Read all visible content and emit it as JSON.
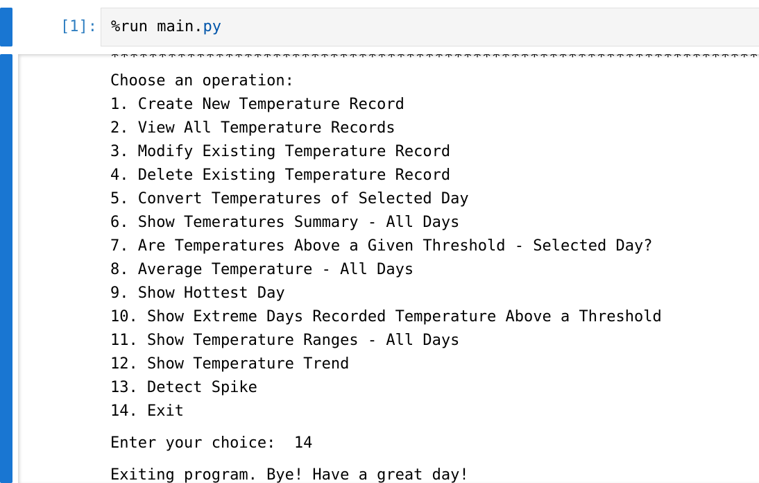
{
  "input_cell": {
    "prompt": "[1]:",
    "code_magic": "%run main",
    "code_dot": ".",
    "code_ext": "py"
  },
  "output": {
    "separator": "**********************************************************************************************",
    "heading": "Choose an operation:",
    "menu_items": [
      "1. Create New Temperature Record",
      "2. View All Temperature Records",
      "3. Modify Existing Temperature Record",
      "4. Delete Existing Temperature Record",
      "5. Convert Temperatures of Selected Day",
      "6. Show Temeratures Summary - All Days",
      "7. Are Temperatures Above a Given Threshold - Selected Day?",
      "8. Average Temperature - All Days",
      "9. Show Hottest Day",
      "10. Show Extreme Days Recorded Temperature Above a Threshold",
      "11. Show Temperature Ranges - All Days",
      "12. Show Temperature Trend",
      "13. Detect Spike",
      "14. Exit"
    ],
    "choice_prompt": "Enter your choice:  14",
    "exit_message": "Exiting program. Bye! Have a great day!"
  },
  "colors": {
    "cell_bar": "#1976d2",
    "prompt": "#307fc1",
    "editor_bg": "#f5f5f5"
  }
}
